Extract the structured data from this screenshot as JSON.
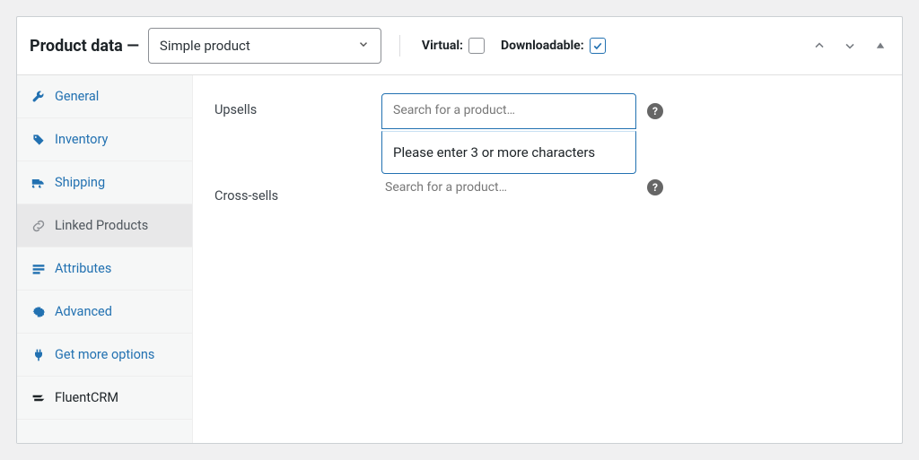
{
  "header": {
    "title_prefix": "Product data",
    "title_dash": " — ",
    "product_type": "Simple product",
    "virtual_label": "Virtual:",
    "downloadable_label": "Downloadable:",
    "virtual_checked": false,
    "downloadable_checked": true
  },
  "tabs": [
    {
      "id": "general",
      "label": "General",
      "icon": "wrench-icon",
      "active": false
    },
    {
      "id": "inventory",
      "label": "Inventory",
      "icon": "tag-icon",
      "active": false
    },
    {
      "id": "shipping",
      "label": "Shipping",
      "icon": "truck-icon",
      "active": false
    },
    {
      "id": "linked",
      "label": "Linked Products",
      "icon": "link-icon",
      "active": true
    },
    {
      "id": "attributes",
      "label": "Attributes",
      "icon": "list-icon",
      "active": false
    },
    {
      "id": "advanced",
      "label": "Advanced",
      "icon": "gear-icon",
      "active": false
    },
    {
      "id": "getmore",
      "label": "Get more options",
      "icon": "plug-icon",
      "active": false
    },
    {
      "id": "fluentcrm",
      "label": "FluentCRM",
      "icon": "fluent-icon",
      "active": false,
      "alt": true
    }
  ],
  "fields": {
    "upsells": {
      "label": "Upsells",
      "placeholder": "Search for a product…",
      "dropdown_message": "Please enter 3 or more characters"
    },
    "crosssells": {
      "label": "Cross-sells",
      "placeholder": "Search for a product…"
    }
  },
  "icons": {
    "help": "?"
  }
}
